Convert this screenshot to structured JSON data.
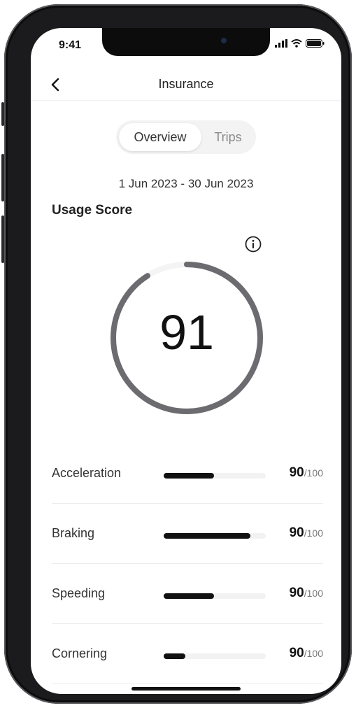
{
  "status_bar": {
    "time": "9:41"
  },
  "header": {
    "title": "Insurance"
  },
  "tabs": [
    {
      "label": "Overview",
      "active": true
    },
    {
      "label": "Trips",
      "active": false
    }
  ],
  "date_range": "1 Jun 2023 - 30 Jun 2023",
  "usage_score": {
    "title": "Usage Score",
    "score": "91",
    "gauge_fraction": 0.91
  },
  "metrics": [
    {
      "label": "Acceleration",
      "value": "90",
      "max": "/100",
      "bar_fraction": 0.49
    },
    {
      "label": "Braking",
      "value": "90",
      "max": "/100",
      "bar_fraction": 0.85
    },
    {
      "label": "Speeding",
      "value": "90",
      "max": "/100",
      "bar_fraction": 0.49
    },
    {
      "label": "Cornering",
      "value": "90",
      "max": "/100",
      "bar_fraction": 0.21
    }
  ],
  "colors": {
    "accent": "#111111",
    "gauge": "#6b6b70",
    "track": "#f2f2f2"
  },
  "icons": [
    "back-chevron-icon",
    "info-icon",
    "signal-icon",
    "wifi-icon",
    "battery-icon"
  ]
}
